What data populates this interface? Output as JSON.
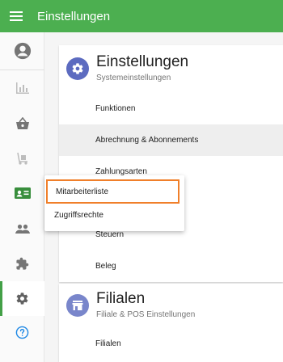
{
  "topbar": {
    "title": "Einstellungen"
  },
  "sidebar": {
    "items": [
      {
        "name": "account",
        "icon": "account-circle-icon"
      },
      {
        "name": "statistics",
        "icon": "bar-chart-icon"
      },
      {
        "name": "shop",
        "icon": "basket-icon"
      },
      {
        "name": "delivery",
        "icon": "hand-truck-icon"
      },
      {
        "name": "employees",
        "icon": "id-card-icon",
        "active": false
      },
      {
        "name": "people",
        "icon": "people-icon"
      },
      {
        "name": "extensions",
        "icon": "puzzle-icon"
      },
      {
        "name": "settings",
        "icon": "gear-icon",
        "active": true
      },
      {
        "name": "help",
        "icon": "help-icon"
      }
    ]
  },
  "settings_card": {
    "title": "Einstellungen",
    "subtitle": "Systemeinstellungen",
    "rows": [
      "Funktionen",
      "Abrechnung & Abonnements",
      "Zahlungsarten",
      "Mitarbeiterliste",
      "Steuern",
      "Beleg"
    ]
  },
  "branches_card": {
    "title": "Filialen",
    "subtitle": "Filiale & POS Einstellungen",
    "rows": [
      "Filialen"
    ]
  },
  "popup_menu": {
    "items": [
      "Mitarbeiterliste",
      "Zugriffsrechte"
    ]
  },
  "colors": {
    "topbar": "#4caf50",
    "accent": "#43a047",
    "settings_icon_bg": "#5c6bc0",
    "branch_icon_bg": "#7986cb",
    "highlight_border": "#f07f2a",
    "sidebar_icon": "#9e9e9e"
  }
}
